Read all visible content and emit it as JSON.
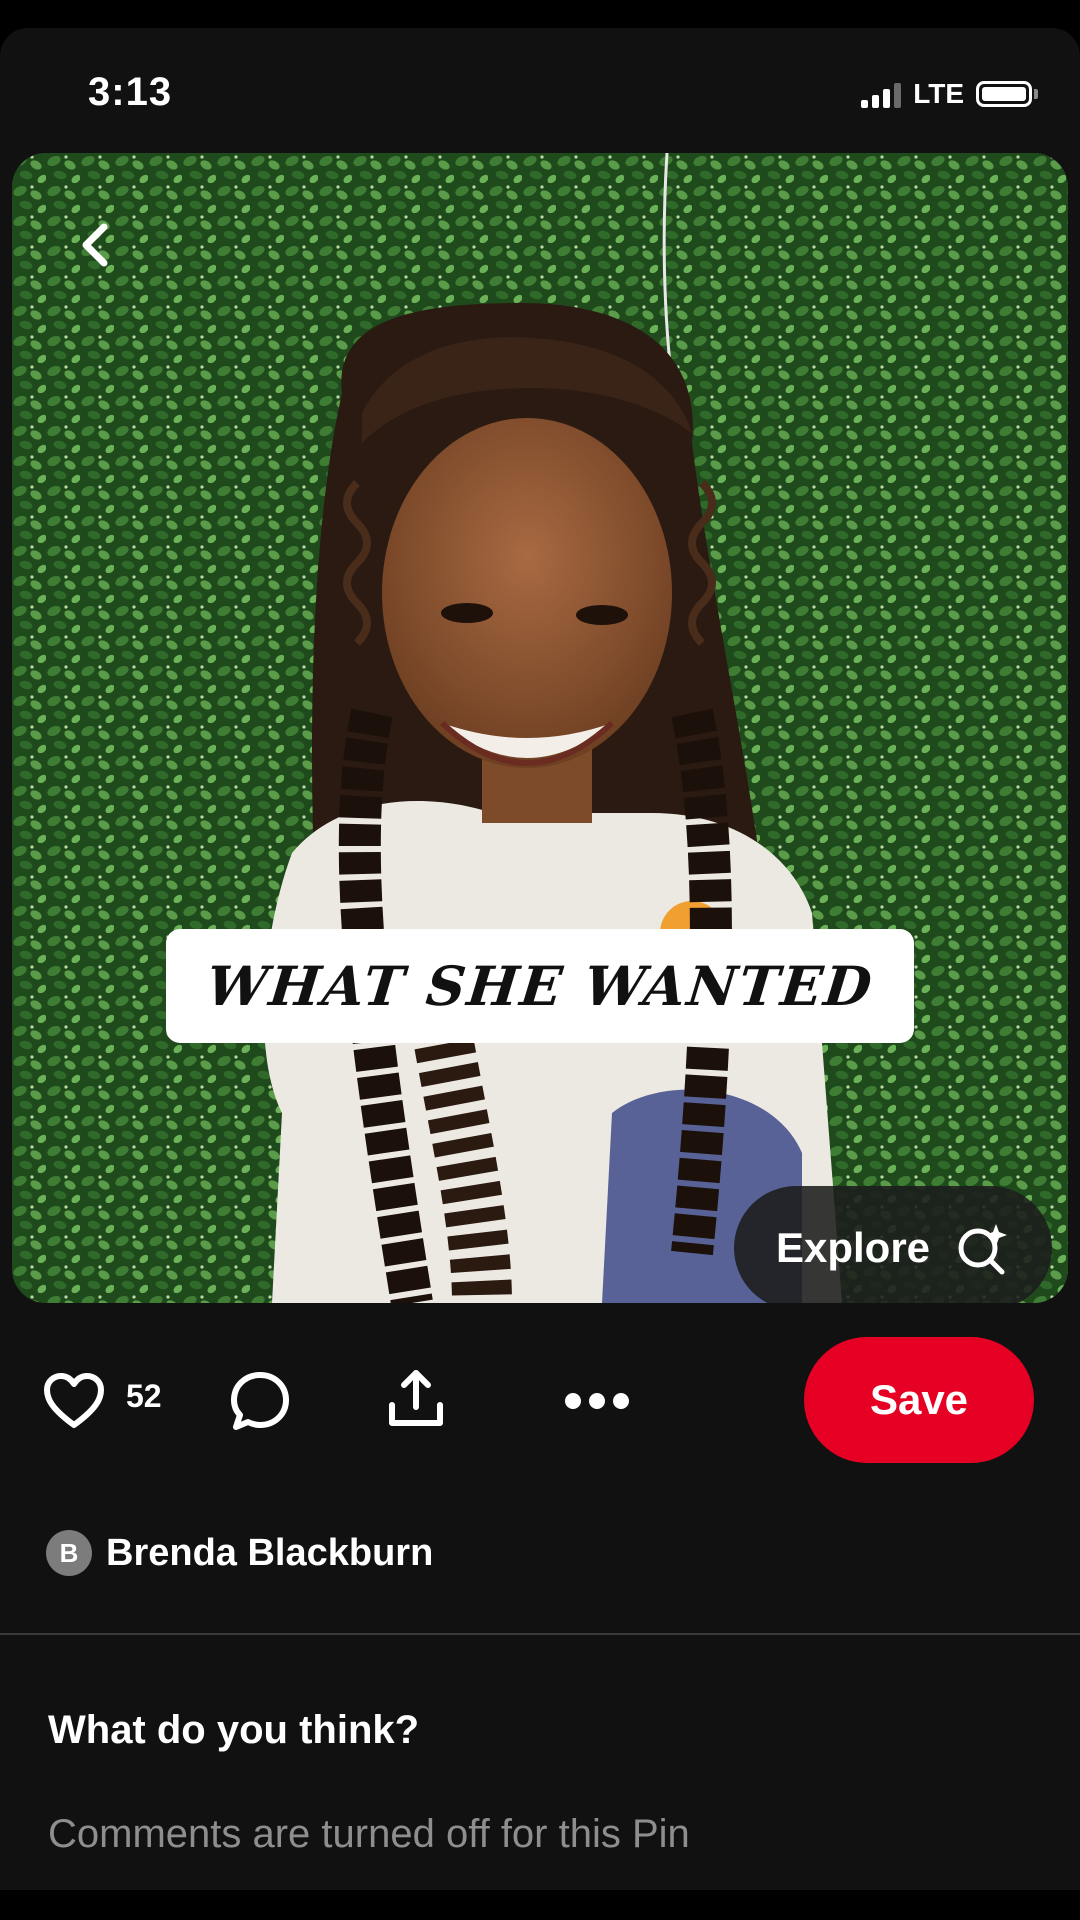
{
  "status_bar": {
    "time": "3:13",
    "network": "LTE"
  },
  "pin": {
    "image_description_icon": "photo-of-girl-with-braids",
    "caption": "What she wanted",
    "explore_label": "Explore",
    "explore_icon": "sparkle-search-icon",
    "back_icon": "chevron-left-icon"
  },
  "actions": {
    "like_icon": "heart-icon",
    "like_count": "52",
    "comment_icon": "comment-icon",
    "share_icon": "share-icon",
    "more_icon": "more-horizontal-icon",
    "save_label": "Save",
    "save_color": "#e60023"
  },
  "author": {
    "initial": "B",
    "name": "Brenda Blackburn"
  },
  "comments": {
    "heading": "What do you think?",
    "status": "Comments are turned off for this Pin"
  }
}
